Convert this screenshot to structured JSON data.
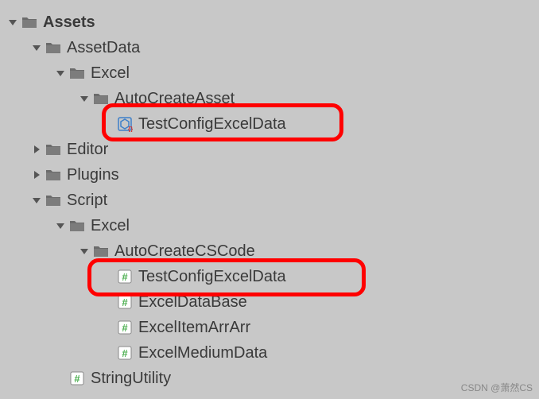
{
  "tree": {
    "assets": "Assets",
    "assetdata": "AssetData",
    "excel1": "Excel",
    "autocreateasset": "AutoCreateAsset",
    "testconfigasset": "TestConfigExcelData",
    "editor": "Editor",
    "plugins": "Plugins",
    "script": "Script",
    "excel2": "Excel",
    "autocreatecs": "AutoCreateCSCode",
    "testconfigcs": "TestConfigExcelData",
    "exceldatabase": "ExcelDataBase",
    "excelitemarrarr": "ExcelItemArrArr",
    "excelmediumdata": "ExcelMediumData",
    "stringutility": "StringUtility"
  },
  "watermark": "CSDN @萧然CS"
}
